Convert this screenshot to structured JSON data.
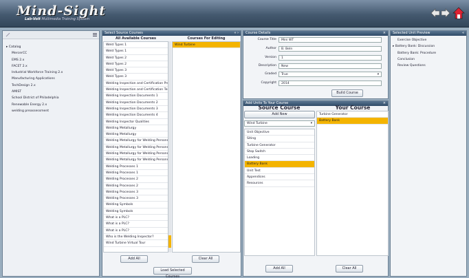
{
  "header": {
    "logo": "Mind-Sight",
    "subtitle_a": "Lab-Volt",
    "subtitle_b": "Multimedia Training System",
    "back_icon": "arrow-left-icon",
    "forward_icon": "arrow-right-icon",
    "home_icon": "home-icon"
  },
  "catalog": {
    "root": "Catalog",
    "items": [
      "MercerCC",
      "EMS 2.x",
      "FACET 2.x",
      "Industrial Workforce Training 2.x",
      "Manufacturing Applications",
      "TechDesign 2.x",
      "AMIST",
      "School District of Philadelphia",
      "Renewable Energy 2.x",
      "welding preassessment"
    ]
  },
  "select_source": {
    "title": "Select Source Courses",
    "col_all": "All Available Courses",
    "col_edit": "Courses For Editing",
    "available": [
      "Weld Types 1",
      "Weld Types 1",
      "Weld Types 2",
      "Weld Types 2",
      "Weld Types 3",
      "Weld Types 3",
      "Welding Inspection and Certification Pre",
      "Welding Inspection and Certification Tes",
      "Welding Inspection Documents 1",
      "Welding Inspection Documents 2",
      "Welding Inspection Documents 3",
      "Welding Inspection Documents 4",
      "Welding Inspector Qualities",
      "Welding Metallurgy",
      "Welding Metallurgy",
      "Welding Metallurgy for Welding Personn",
      "Welding Metallurgy for Welding Personn",
      "Welding Metallurgy for Welding Personn",
      "Welding Metallurgy for Welding Personn",
      "Welding Processes 1",
      "Welding Processes 1",
      "Welding Processes 2",
      "Welding Processes 2",
      "Welding Processes 3",
      "Welding Processes 3",
      "Welding Symbols",
      "Welding Symbols",
      "What is a PLC?",
      "What is a PLC?",
      "What is a PLC?",
      "Who is the Welding Inspector?",
      "Wind Turbine Virtual Tour"
    ],
    "editing": [
      "Wind Turbine"
    ],
    "add_all": "Add All",
    "clear_all": "Clear All",
    "load": "Load Selected Courses"
  },
  "course_details": {
    "title": "Course Details",
    "labels": {
      "title": "Course Title",
      "author": "Author",
      "version": "Version",
      "description": "Description",
      "graded": "Graded",
      "copyright": "Copyright"
    },
    "values": {
      "title": "Mini WT",
      "author": "B. Beln",
      "version": "1",
      "description": "New",
      "graded": "True",
      "copyright": "2014"
    },
    "build": "Build Course"
  },
  "add_units": {
    "title": "Add Units To Your Course",
    "source_head": "Source Course",
    "your_head": "Your Course",
    "add_new": "Add New",
    "source_select": "Wind Turbine",
    "source_units": [
      "Unit Objective",
      "Siting",
      "Turbine Generator",
      "Stop Switch",
      "Loading",
      "Battery Bank",
      "Unit Test",
      "Appendices",
      "Resources"
    ],
    "source_selected": "Battery Bank",
    "your_units": [
      "Turbine Generator",
      "Battery Bank"
    ],
    "your_selected": "Battery Bank",
    "add_all": "Add All",
    "clear_all": "Clear All"
  },
  "preview": {
    "title": "Selected Unit Preview",
    "items": [
      "Exercise Objective",
      "Battery Bank: Discussion",
      "Battery Bank: Procedure",
      "Conclusion",
      "Review Questions"
    ]
  }
}
